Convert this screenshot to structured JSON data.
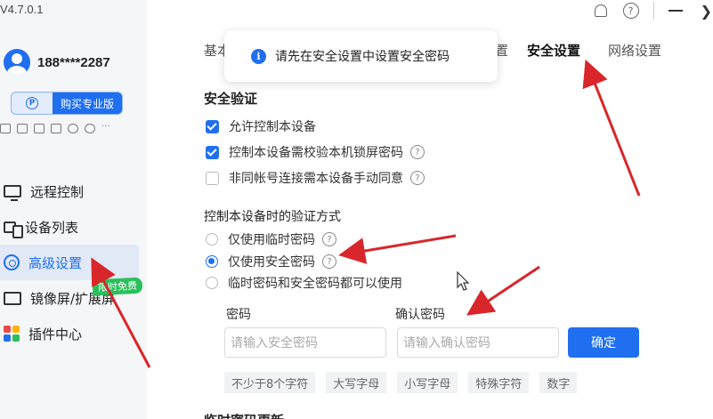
{
  "app": {
    "version": "V4.7.0.1"
  },
  "user": {
    "name": "188****2287"
  },
  "sidebar": {
    "pro_button": "购买专业版",
    "free_badge": "限时免费",
    "items": [
      {
        "label": "远程控制",
        "icon": "monitor-icon"
      },
      {
        "label": "设备列表",
        "icon": "devices-icon"
      },
      {
        "label": "高级设置",
        "icon": "settings-icon",
        "active": true
      },
      {
        "label": "镜像屏/扩展屏",
        "icon": "mirror-screen-icon"
      },
      {
        "label": "插件中心",
        "icon": "plugin-icon"
      }
    ]
  },
  "tabs": {
    "first": "基本",
    "third_tail": "置",
    "security": "安全设置",
    "network": "网络设置"
  },
  "toast": {
    "text": "请先在安全设置中设置安全密码",
    "icon": "info-icon"
  },
  "security": {
    "title": "安全验证",
    "options": [
      {
        "label": "允许控制本设备",
        "checked": true
      },
      {
        "label": "控制本设备需校验本机锁屏密码",
        "checked": true
      },
      {
        "label": "非同帐号连接需本设备手动同意",
        "checked": false
      }
    ]
  },
  "verify": {
    "title": "控制本设备时的验证方式",
    "options": [
      {
        "label": "仅使用临时密码",
        "selected": false
      },
      {
        "label": "仅使用安全密码",
        "selected": true
      },
      {
        "label": "临时密码和安全密码都可以使用",
        "selected": false
      }
    ]
  },
  "password": {
    "label": "密码",
    "placeholder": "请输入安全密码",
    "confirm_label": "确认密码",
    "confirm_placeholder": "请输入确认密码",
    "ok": "确定",
    "rules": [
      "不少于8个字符",
      "大写字母",
      "小写字母",
      "特殊字符",
      "数字"
    ]
  },
  "next_section": "临时密码更新",
  "colors": {
    "accent": "#1f6ff0",
    "annotation": "#d9262a",
    "badge": "#2bbf5b"
  }
}
